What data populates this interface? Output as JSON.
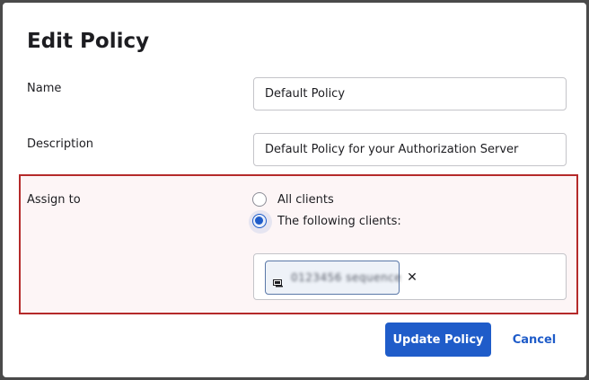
{
  "dialog": {
    "title": "Edit Policy"
  },
  "fields": {
    "name_label": "Name",
    "name_value": "Default Policy",
    "description_label": "Description",
    "description_value": "Default Policy for your Authorization Server"
  },
  "assign": {
    "label": "Assign to",
    "options": [
      {
        "label": "All clients",
        "checked": false
      },
      {
        "label": "The following clients:",
        "checked": true
      }
    ],
    "selected_client": {
      "name": "0123456 sequence",
      "icon": "client-app-icon"
    }
  },
  "actions": {
    "primary_label": "Update Policy",
    "cancel_label": "Cancel"
  },
  "colors": {
    "accent": "#1f5cc9",
    "highlight_border": "#b52a2a"
  }
}
